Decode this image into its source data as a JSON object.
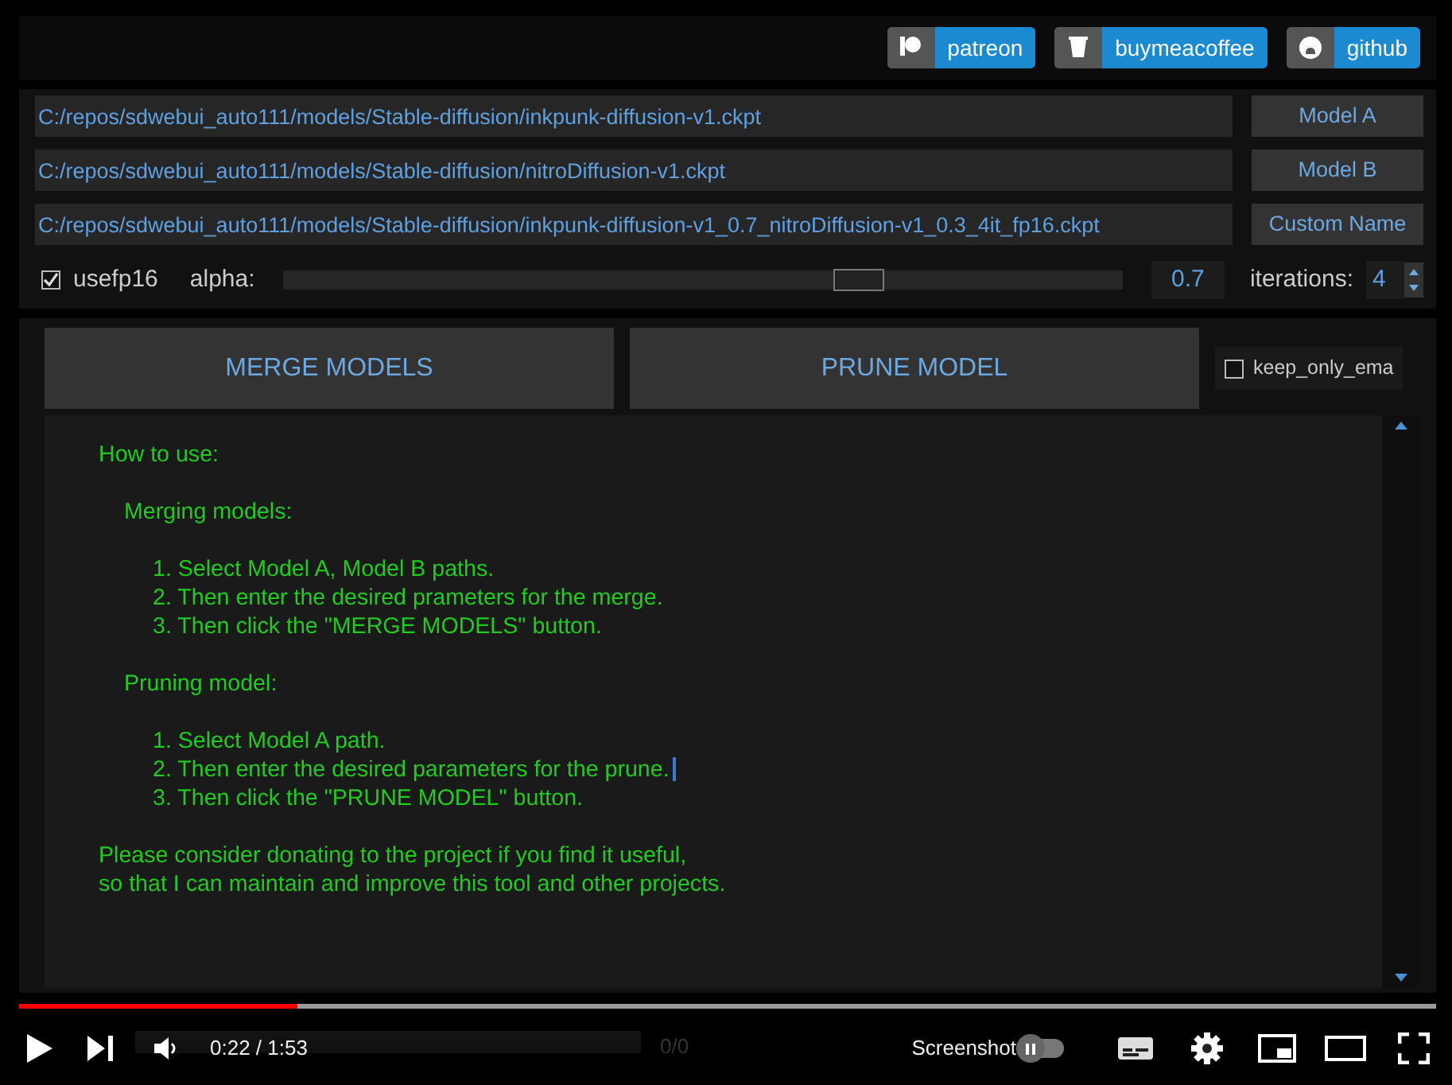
{
  "header": {
    "links": [
      {
        "label": "patreon",
        "kind": "patreon"
      },
      {
        "label": "buymeacoffee",
        "kind": "coffee"
      },
      {
        "label": "github",
        "kind": "github"
      }
    ]
  },
  "model_paths": [
    {
      "value": "C:/repos/sdwebui_auto111/models/Stable-diffusion/inkpunk-diffusion-v1.ckpt",
      "button": "Model A"
    },
    {
      "value": "C:/repos/sdwebui_auto111/models/Stable-diffusion/nitroDiffusion-v1.ckpt",
      "button": "Model B"
    },
    {
      "value": "C:/repos/sdwebui_auto111/models/Stable-diffusion/inkpunk-diffusion-v1_0.7_nitroDiffusion-v1_0.3_4it_fp16.ckpt",
      "button": "Custom Name"
    }
  ],
  "options": {
    "usefp16": {
      "label": "usefp16",
      "checked": true
    },
    "alpha": {
      "label": "alpha:",
      "level": 0.685,
      "reading": "0.7"
    },
    "iterations": {
      "label": "iterations:",
      "value": "4"
    }
  },
  "actions": {
    "merge": "MERGE MODELS",
    "prune": "PRUNE MODEL",
    "keep_only_ema": {
      "label": "keep_only_ema",
      "checked": false
    }
  },
  "output": {
    "blocks": [
      {
        "kind": "heading",
        "lines": [
          "How to use:"
        ]
      },
      {
        "kind": "section",
        "lines": [
          "Merging models:"
        ]
      },
      {
        "kind": "steps",
        "lines": [
          "1. Select Model A, Model B paths.",
          "2. Then enter the desired prameters for the merge.",
          "3. Then click the \"MERGE MODELS\" button."
        ]
      },
      {
        "kind": "section",
        "lines": [
          "Pruning model:"
        ]
      },
      {
        "kind": "steps",
        "lines": [
          "1. Select Model A path.",
          "2. Then enter the desired parameters for the prune.",
          "3. Then click the \"PRUNE MODEL\" button."
        ]
      },
      {
        "kind": "heading",
        "lines": [
          "Please consider donating to the project if you find it useful,",
          "so that I can maintain and improve this tool and other projects."
        ]
      }
    ]
  },
  "background_progress": {
    "count": "0/0"
  },
  "player": {
    "progress": {
      "level": 0.196
    },
    "time": "0:22 / 1:53",
    "toggle": {
      "label": "Screenshot",
      "on": false
    }
  }
}
